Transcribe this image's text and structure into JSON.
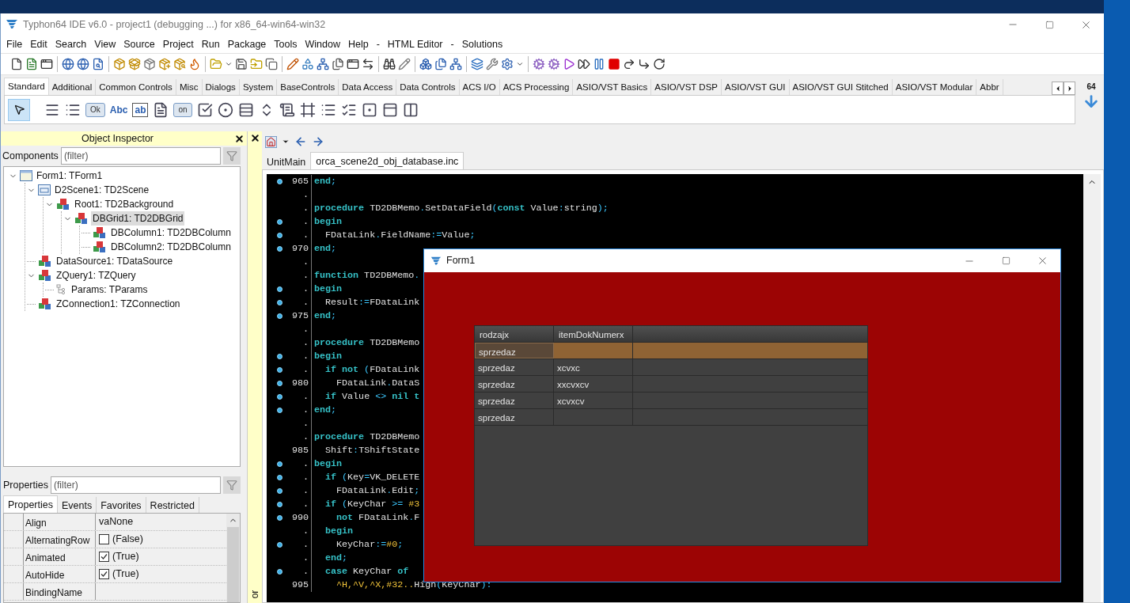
{
  "window": {
    "title": "Typhon64 IDE v6.0 - project1 (debugging ...) for x86_64-win64-win32"
  },
  "menu": [
    "File",
    "Edit",
    "Search",
    "View",
    "Source",
    "Project",
    "Run",
    "Package",
    "Tools",
    "Window",
    "Help",
    "-",
    "HTML Editor",
    "-",
    "Solutions"
  ],
  "palette": {
    "tabs": [
      {
        "label": "Standard",
        "selected": true
      },
      {
        "label": "Additional",
        "selected": false
      },
      {
        "label": "Common Controls",
        "selected": false
      },
      {
        "label": "Misc",
        "selected": false
      },
      {
        "label": "Dialogs",
        "selected": false
      },
      {
        "label": "System",
        "selected": false
      },
      {
        "label": "BaseControls",
        "selected": false
      },
      {
        "label": "Data Access",
        "selected": false
      },
      {
        "label": "Data Controls",
        "selected": false
      },
      {
        "label": "ACS I/O",
        "selected": false
      },
      {
        "label": "ACS Processing",
        "selected": false
      },
      {
        "label": "ASIO/VST Basics",
        "selected": false
      },
      {
        "label": "ASIO/VST DSP",
        "selected": false
      },
      {
        "label": "ASIO/VST GUI",
        "selected": false
      },
      {
        "label": "ASIO/VST GUI Stitched",
        "selected": false
      },
      {
        "label": "ASIO/VST Modular",
        "selected": false
      },
      {
        "label": "Abbr",
        "selected": false
      }
    ],
    "items": [
      {
        "kind": "pointer",
        "selected": true
      },
      {
        "kind": "icon"
      },
      {
        "kind": "icon"
      },
      {
        "kind": "button",
        "text": "Ok"
      },
      {
        "kind": "label",
        "text": "Abc"
      },
      {
        "kind": "edit",
        "text": "ab"
      },
      {
        "kind": "icon"
      },
      {
        "kind": "button",
        "text": "on"
      },
      {
        "kind": "icon"
      },
      {
        "kind": "icon"
      },
      {
        "kind": "icon"
      },
      {
        "kind": "icon"
      },
      {
        "kind": "icon"
      },
      {
        "kind": "icon"
      },
      {
        "kind": "icon"
      },
      {
        "kind": "icon"
      },
      {
        "kind": "icon"
      },
      {
        "kind": "icon"
      },
      {
        "kind": "icon"
      }
    ],
    "bitness": "64"
  },
  "object_inspector": {
    "title": "Object Inspector",
    "components_label": "Components",
    "filter_placeholder": "(filter)",
    "tree": [
      {
        "label": "Form1: TForm1",
        "kind": "form",
        "expanded": true,
        "selected": false,
        "children": [
          {
            "label": "D2Scene1: TD2Scene",
            "kind": "scene",
            "expanded": true,
            "selected": false,
            "children": [
              {
                "label": "Root1: TD2Background",
                "kind": "component",
                "expanded": true,
                "selected": false,
                "children": [
                  {
                    "label": "DBGrid1: TD2DBGrid",
                    "kind": "component",
                    "expanded": true,
                    "selected": true,
                    "children": [
                      {
                        "label": "DBColumn1: TD2DBColumn",
                        "kind": "component",
                        "selected": false
                      },
                      {
                        "label": "DBColumn2: TD2DBColumn",
                        "kind": "component",
                        "selected": false
                      }
                    ]
                  }
                ]
              }
            ]
          },
          {
            "label": "DataSource1: TDataSource",
            "kind": "component",
            "selected": false
          },
          {
            "label": "ZQuery1: TZQuery",
            "kind": "component",
            "expanded": true,
            "selected": false,
            "children": [
              {
                "label": "Params: TParams",
                "kind": "params",
                "selected": false
              }
            ]
          },
          {
            "label": "ZConnection1: TZConnection",
            "kind": "component",
            "selected": false
          }
        ]
      }
    ],
    "properties_label": "Properties",
    "properties_placeholder": "(filter)",
    "tabs": [
      {
        "label": "Properties",
        "selected": true
      },
      {
        "label": "Events",
        "selected": false
      },
      {
        "label": "Favorites",
        "selected": false
      },
      {
        "label": "Restricted",
        "selected": false
      }
    ],
    "properties": [
      {
        "name": "Align",
        "kind": "text",
        "value": "vaNone"
      },
      {
        "name": "AlternatingRow",
        "kind": "bool",
        "checked": false,
        "value": "(False)"
      },
      {
        "name": "Animated",
        "kind": "bool",
        "checked": true,
        "value": "(True)"
      },
      {
        "name": "AutoHide",
        "kind": "bool",
        "checked": true,
        "value": "(True)"
      },
      {
        "name": "BindingName",
        "kind": "text"
      }
    ]
  },
  "side_strip": {
    "caption": "or"
  },
  "editor": {
    "tabs": [
      {
        "label": "UnitMain",
        "selected": false
      },
      {
        "label": "orca_scene2d_obj_database.inc",
        "selected": true
      }
    ],
    "lines": [
      {
        "num": "965",
        "marked": true,
        "segments": [
          {
            "kind": "kw",
            "text": "end"
          },
          {
            "kind": "sym",
            "text": ";"
          }
        ]
      },
      {
        "num": ".",
        "marked": false
      },
      {
        "num": ".",
        "marked": false,
        "segments": [
          {
            "kind": "kw",
            "text": "procedure"
          },
          {
            "kind": "id",
            "text": " TD2DBMemo"
          },
          {
            "kind": "sym",
            "text": "."
          },
          {
            "kind": "id",
            "text": "SetDataField"
          },
          {
            "kind": "sym",
            "text": "("
          },
          {
            "kind": "kw",
            "text": "const"
          },
          {
            "kind": "id",
            "text": " Value"
          },
          {
            "kind": "sym",
            "text": ":"
          },
          {
            "kind": "id",
            "text": "string"
          },
          {
            "kind": "sym",
            "text": ");"
          }
        ]
      },
      {
        "num": ".",
        "marked": true,
        "segments": [
          {
            "kind": "kw",
            "text": "begin"
          }
        ]
      },
      {
        "num": ".",
        "marked": true,
        "segments": [
          {
            "kind": "id",
            "text": "  FDataLink"
          },
          {
            "kind": "sym",
            "text": "."
          },
          {
            "kind": "id",
            "text": "FieldName"
          },
          {
            "kind": "sym",
            "text": ":="
          },
          {
            "kind": "id",
            "text": "Value"
          },
          {
            "kind": "sym",
            "text": ";"
          }
        ]
      },
      {
        "num": "970",
        "marked": true,
        "segments": [
          {
            "kind": "kw",
            "text": "end"
          },
          {
            "kind": "sym",
            "text": ";"
          }
        ]
      },
      {
        "num": ".",
        "marked": false
      },
      {
        "num": ".",
        "marked": false,
        "segments": [
          {
            "kind": "kw",
            "text": "function"
          },
          {
            "kind": "id",
            "text": " TD2DBMemo"
          },
          {
            "kind": "sym",
            "text": "."
          }
        ]
      },
      {
        "num": ".",
        "marked": true,
        "segments": [
          {
            "kind": "kw",
            "text": "begin"
          }
        ]
      },
      {
        "num": ".",
        "marked": true,
        "segments": [
          {
            "kind": "id",
            "text": "  Result"
          },
          {
            "kind": "sym",
            "text": ":="
          },
          {
            "kind": "id",
            "text": "FDataLink"
          }
        ]
      },
      {
        "num": "975",
        "marked": true,
        "segments": [
          {
            "kind": "kw",
            "text": "end"
          },
          {
            "kind": "sym",
            "text": ";"
          }
        ]
      },
      {
        "num": ".",
        "marked": false
      },
      {
        "num": ".",
        "marked": false,
        "segments": [
          {
            "kind": "kw",
            "text": "procedure"
          },
          {
            "kind": "id",
            "text": " TD2DBMemo"
          }
        ]
      },
      {
        "num": ".",
        "marked": true,
        "segments": [
          {
            "kind": "kw",
            "text": "begin"
          }
        ]
      },
      {
        "num": ".",
        "marked": true,
        "segments": [
          {
            "kind": "kw",
            "text": "  if not"
          },
          {
            "kind": "sym",
            "text": " ("
          },
          {
            "kind": "id",
            "text": "FDataLink"
          }
        ]
      },
      {
        "num": "980",
        "marked": true,
        "segments": [
          {
            "kind": "id",
            "text": "    FDataLink"
          },
          {
            "kind": "sym",
            "text": "."
          },
          {
            "kind": "id",
            "text": "DataS"
          }
        ]
      },
      {
        "num": ".",
        "marked": true,
        "segments": [
          {
            "kind": "kw",
            "text": "  if"
          },
          {
            "kind": "id",
            "text": " Value "
          },
          {
            "kind": "sym",
            "text": "<>"
          },
          {
            "kind": "kw",
            "text": " nil t"
          }
        ]
      },
      {
        "num": ".",
        "marked": true,
        "segments": [
          {
            "kind": "kw",
            "text": "end"
          },
          {
            "kind": "sym",
            "text": ";"
          }
        ]
      },
      {
        "num": ".",
        "marked": false
      },
      {
        "num": ".",
        "marked": false,
        "segments": [
          {
            "kind": "kw",
            "text": "procedure"
          },
          {
            "kind": "id",
            "text": " TD2DBMemo"
          }
        ]
      },
      {
        "num": "985",
        "marked": false,
        "segments": [
          {
            "kind": "id",
            "text": "  Shift"
          },
          {
            "kind": "sym",
            "text": ":"
          },
          {
            "kind": "id",
            "text": "TShiftState"
          }
        ]
      },
      {
        "num": ".",
        "marked": true,
        "segments": [
          {
            "kind": "kw",
            "text": "begin"
          }
        ]
      },
      {
        "num": ".",
        "marked": true,
        "segments": [
          {
            "kind": "kw",
            "text": "  if"
          },
          {
            "kind": "sym",
            "text": " ("
          },
          {
            "kind": "id",
            "text": "Key"
          },
          {
            "kind": "sym",
            "text": "="
          },
          {
            "kind": "id",
            "text": "VK_DELETE"
          }
        ]
      },
      {
        "num": ".",
        "marked": true,
        "segments": [
          {
            "kind": "id",
            "text": "    FDataLink"
          },
          {
            "kind": "sym",
            "text": "."
          },
          {
            "kind": "id",
            "text": "Edit"
          },
          {
            "kind": "sym",
            "text": ";"
          }
        ]
      },
      {
        "num": ".",
        "marked": true,
        "segments": [
          {
            "kind": "kw",
            "text": "  if"
          },
          {
            "kind": "sym",
            "text": " ("
          },
          {
            "kind": "id",
            "text": "KeyChar "
          },
          {
            "kind": "sym",
            "text": ">="
          },
          {
            "kind": "num",
            "text": " #3"
          }
        ]
      },
      {
        "num": "990",
        "marked": true,
        "segments": [
          {
            "kind": "kw",
            "text": "    not"
          },
          {
            "kind": "id",
            "text": " FDataLink"
          },
          {
            "kind": "sym",
            "text": "."
          },
          {
            "kind": "id",
            "text": "F"
          }
        ]
      },
      {
        "num": ".",
        "marked": false,
        "segments": [
          {
            "kind": "kw",
            "text": "  begin"
          }
        ]
      },
      {
        "num": ".",
        "marked": true,
        "segments": [
          {
            "kind": "id",
            "text": "    KeyChar"
          },
          {
            "kind": "sym",
            "text": ":="
          },
          {
            "kind": "num",
            "text": "#0"
          },
          {
            "kind": "sym",
            "text": ";"
          }
        ]
      },
      {
        "num": ".",
        "marked": false,
        "segments": [
          {
            "kind": "kw",
            "text": "  end"
          },
          {
            "kind": "sym",
            "text": ";"
          }
        ]
      },
      {
        "num": ".",
        "marked": true,
        "segments": [
          {
            "kind": "kw",
            "text": "  case"
          },
          {
            "kind": "id",
            "text": " KeyChar "
          },
          {
            "kind": "kw",
            "text": "of"
          }
        ]
      },
      {
        "num": "995",
        "marked": false,
        "segments": [
          {
            "kind": "num",
            "text": "    ^H,^V,^X,#32.."
          },
          {
            "kind": "id",
            "text": "High"
          },
          {
            "kind": "sym",
            "text": "("
          },
          {
            "kind": "id",
            "text": "KeyChar"
          },
          {
            "kind": "sym",
            "text": "):"
          }
        ]
      }
    ]
  },
  "form": {
    "title": "Form1",
    "grid": {
      "columns": [
        "rodzajx",
        "itemDokNumerx"
      ],
      "rows": [
        {
          "selected": true,
          "cells": [
            "sprzedaz"
          ]
        },
        {
          "selected": false,
          "cells": [
            "sprzedaz",
            "xcvxc"
          ]
        },
        {
          "selected": false,
          "cells": [
            "sprzedaz",
            "xxcvxcv"
          ]
        },
        {
          "selected": false,
          "cells": [
            "sprzedaz",
            "xcvxcv"
          ]
        },
        {
          "selected": false,
          "cells": [
            "sprzedaz"
          ]
        }
      ]
    }
  }
}
